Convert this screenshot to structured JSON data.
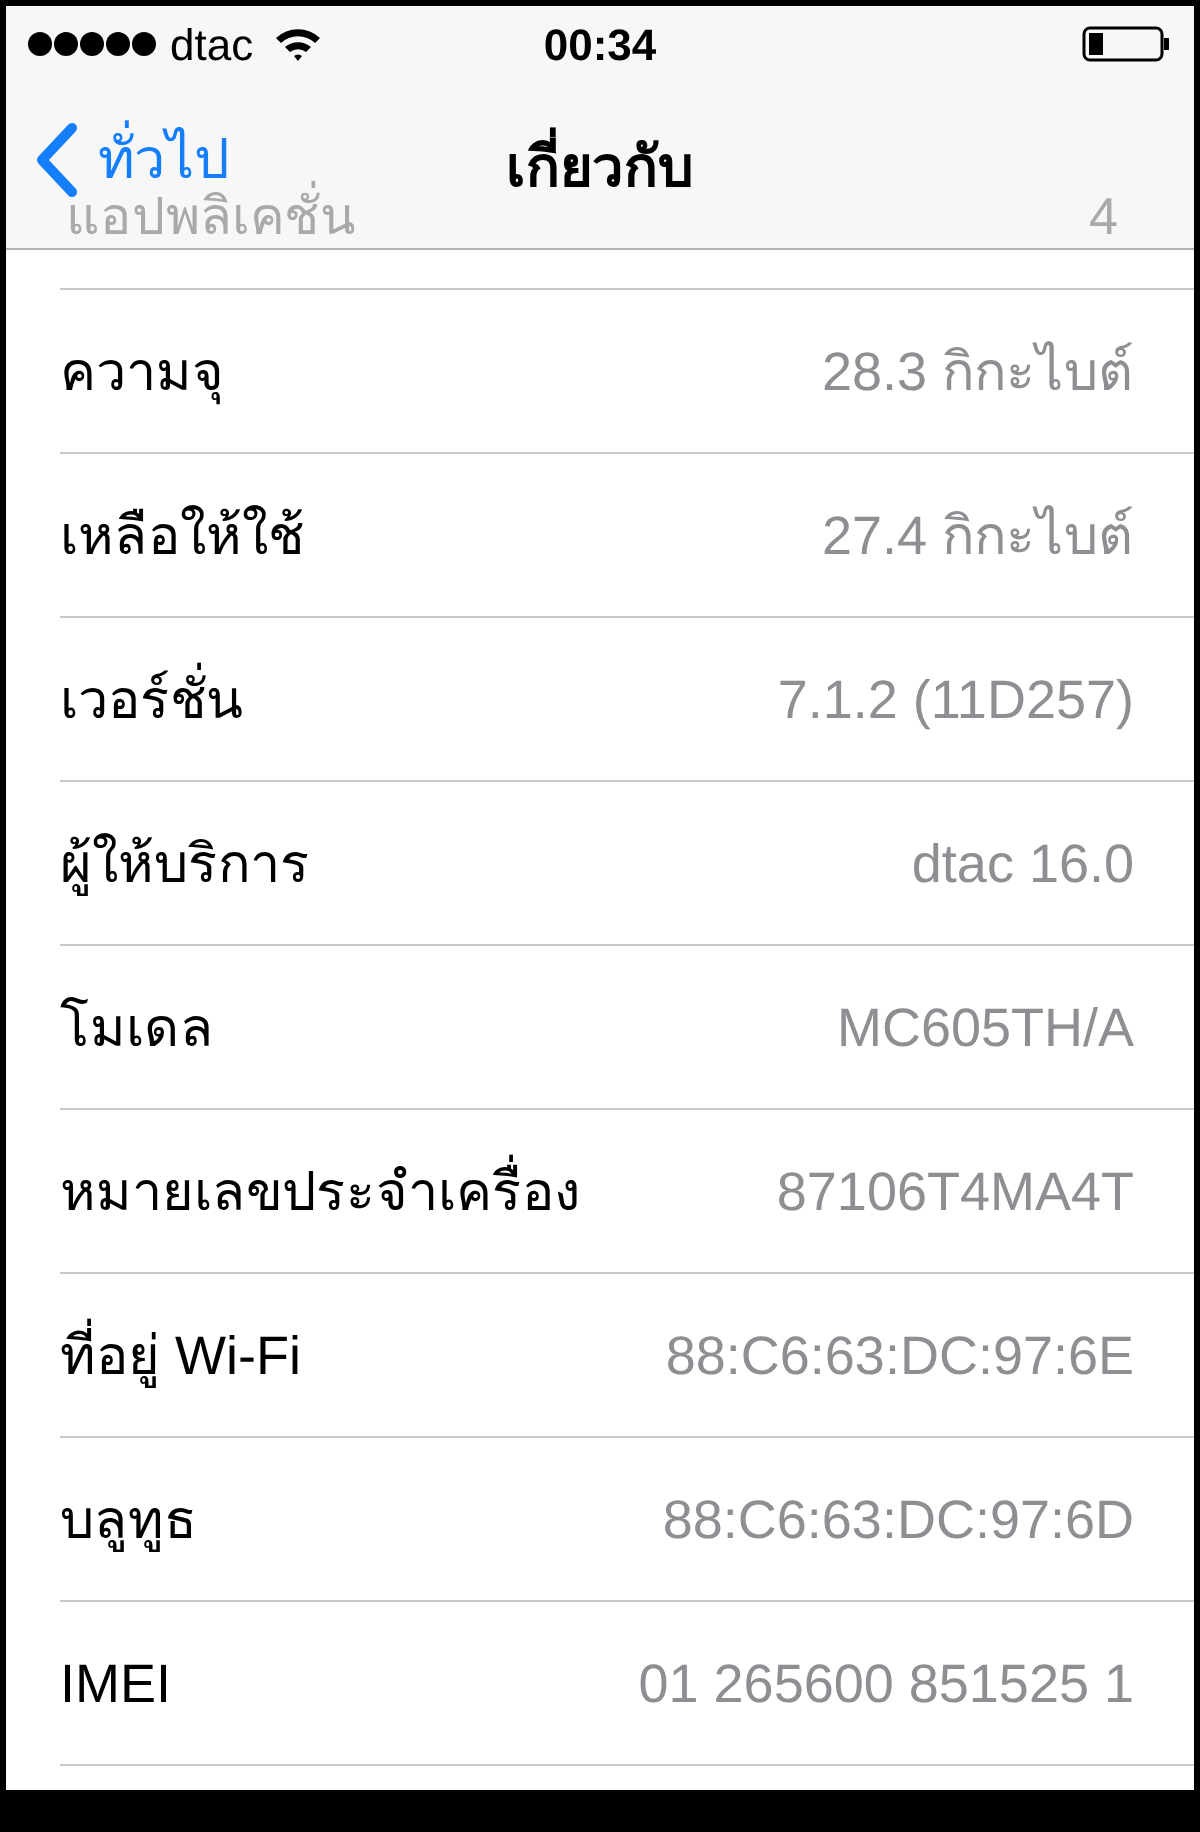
{
  "status_bar": {
    "carrier": "dtac",
    "time": "00:34"
  },
  "nav": {
    "back": "ทั่วไป",
    "title": "เกี่ยวกับ"
  },
  "hidden_row": {
    "label": "แอปพลิเคชั่น",
    "value": "4"
  },
  "rows": [
    {
      "label": "ความจุ",
      "value": "28.3 กิกะไบต์"
    },
    {
      "label": "เหลือให้ใช้",
      "value": "27.4 กิกะไบต์"
    },
    {
      "label": "เวอร์ชั่น",
      "value": "7.1.2 (11D257)"
    },
    {
      "label": "ผู้ให้บริการ",
      "value": "dtac 16.0"
    },
    {
      "label": "โมเดล",
      "value": "MC605TH/A"
    },
    {
      "label": "หมายเลขประจำเครื่อง",
      "value": "87106T4MA4T"
    },
    {
      "label": "ที่อยู่ Wi-Fi",
      "value": "88:C6:63:DC:97:6E"
    },
    {
      "label": "บลูทูธ",
      "value": "88:C6:63:DC:97:6D"
    },
    {
      "label": "IMEI",
      "value": "01 265600 851525 1"
    }
  ]
}
